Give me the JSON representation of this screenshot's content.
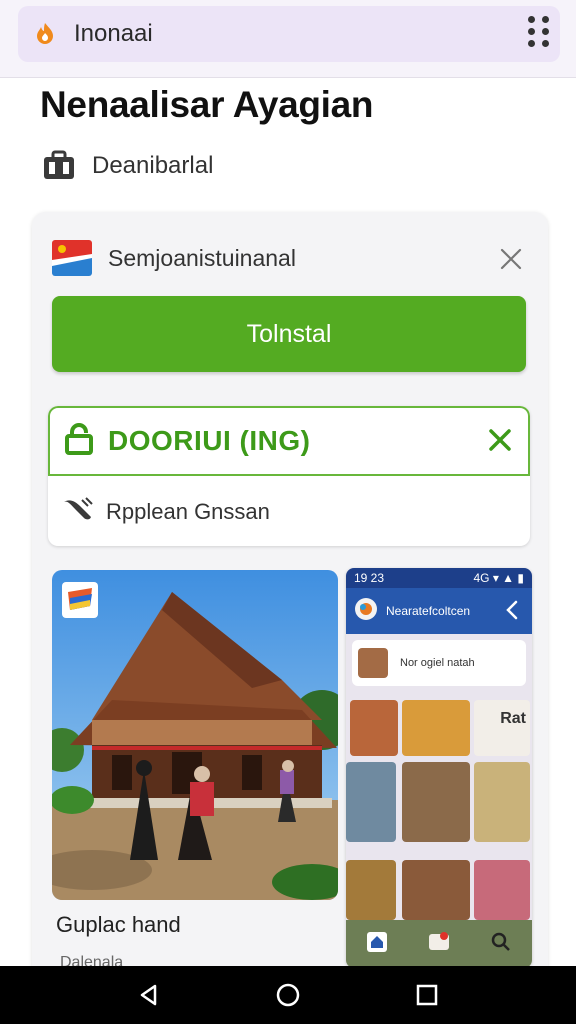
{
  "browser": {
    "url_text": "Inonaai",
    "menu_icon": "more-vertical-icon",
    "logo_icon": "flame-logo-icon",
    "accent": "#ece4f7"
  },
  "page": {
    "title": "Nenaalisar Ayagian",
    "subtitle": "Deanibarlal"
  },
  "card": {
    "banner_text": "Semjoanistuinanal",
    "install_label": "Tolnstal",
    "install_color": "#54ab22",
    "notice_title": "DOORIUI (ING)",
    "notice_sub": "Rpplean Gnssan",
    "notice_color": "#3d9a19",
    "photo_caption": "Guplac hand",
    "cut_text": "Dalenala"
  },
  "phone": {
    "time": "19 23",
    "status_right": "4G ▾ ▲ ▮",
    "app_title": "Nearatefcoltcen",
    "row_text": "Nor ogiel natah",
    "tile_text": "Rat"
  }
}
